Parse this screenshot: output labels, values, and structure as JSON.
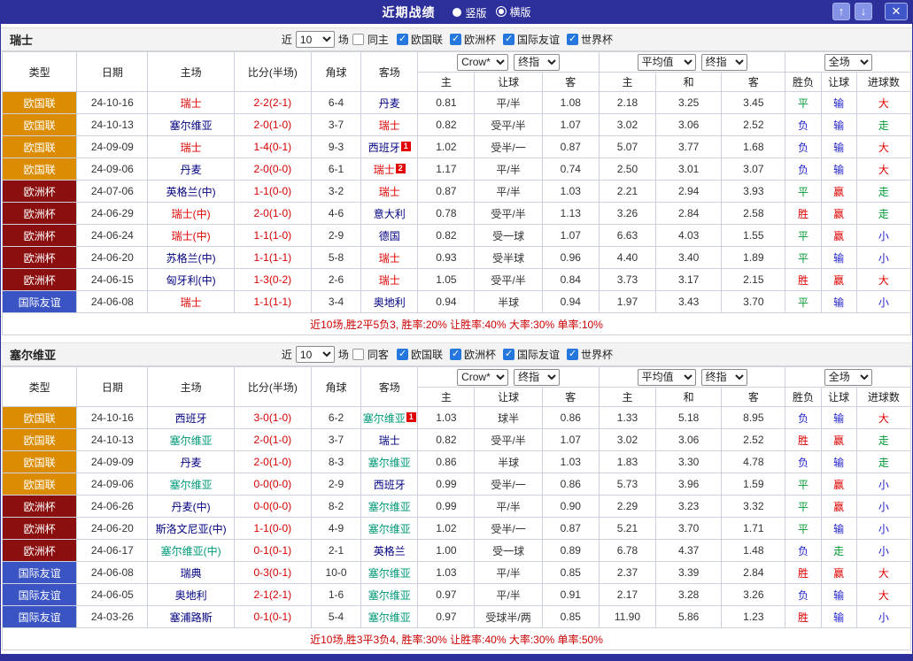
{
  "titlebar": {
    "title": "近期战绩",
    "layout_options": [
      {
        "label": "竖版",
        "selected": false
      },
      {
        "label": "横版",
        "selected": true
      }
    ],
    "icons": {
      "up": "↑",
      "down": "↓",
      "close": "✕"
    }
  },
  "colors": {
    "titlebar_bg": "#2d2f9b",
    "comp": {
      "欧国联": "#db8c00",
      "欧洲杯": "#8c0f0f",
      "国际友谊": "#3b54c4"
    },
    "result": {
      "red": "#e00000",
      "blue": "#2222cc",
      "green": "#009933"
    },
    "score": "#d60000",
    "team_default": "#000080",
    "summary": "#cc0000",
    "checkbox_checked": "#2577de"
  },
  "sections": [
    {
      "team": "瑞士",
      "focal_color": "#e00000",
      "filter": {
        "near_label": "近",
        "count": "10",
        "matches_label": "场",
        "same_label": "同主",
        "same_checked": false,
        "competitions": [
          {
            "label": "欧国联",
            "checked": true
          },
          {
            "label": "欧洲杯",
            "checked": true
          },
          {
            "label": "国际友谊",
            "checked": true
          },
          {
            "label": "世界杯",
            "checked": true
          }
        ]
      },
      "dropdowns": {
        "ah_book": "Crow*",
        "ah_time": "终指",
        "eu_avg": "平均值",
        "eu_time": "终指",
        "scope": "全场"
      },
      "columns": [
        "类型",
        "日期",
        "主场",
        "比分(半场)",
        "角球",
        "客场",
        "主",
        "让球",
        "客",
        "主",
        "和",
        "客",
        "胜负",
        "让球",
        "进球数"
      ],
      "rows": [
        {
          "comp": "欧国联",
          "date": "24-10-16",
          "home": {
            "name": "瑞士",
            "focal": true
          },
          "score": "2-2(2-1)",
          "corner": "6-4",
          "away": {
            "name": "丹麦"
          },
          "ah": [
            "0.81",
            "平/半",
            "1.08"
          ],
          "eu": [
            "2.18",
            "3.25",
            "3.45"
          ],
          "results": [
            [
              "平",
              "green"
            ],
            [
              "输",
              "blue"
            ],
            [
              "大",
              "red"
            ]
          ]
        },
        {
          "comp": "欧国联",
          "date": "24-10-13",
          "home": {
            "name": "塞尔维亚"
          },
          "score": "2-0(1-0)",
          "corner": "3-7",
          "away": {
            "name": "瑞士",
            "focal": true
          },
          "ah": [
            "0.82",
            "受平/半",
            "1.07"
          ],
          "eu": [
            "3.02",
            "3.06",
            "2.52"
          ],
          "results": [
            [
              "负",
              "blue"
            ],
            [
              "输",
              "blue"
            ],
            [
              "走",
              "green"
            ]
          ]
        },
        {
          "comp": "欧国联",
          "date": "24-09-09",
          "home": {
            "name": "瑞士",
            "focal": true
          },
          "score": "1-4(0-1)",
          "corner": "9-3",
          "away": {
            "name": "西班牙",
            "sup": "1"
          },
          "ah": [
            "1.02",
            "受半/一",
            "0.87"
          ],
          "eu": [
            "5.07",
            "3.77",
            "1.68"
          ],
          "results": [
            [
              "负",
              "blue"
            ],
            [
              "输",
              "blue"
            ],
            [
              "大",
              "red"
            ]
          ]
        },
        {
          "comp": "欧国联",
          "date": "24-09-06",
          "home": {
            "name": "丹麦"
          },
          "score": "2-0(0-0)",
          "corner": "6-1",
          "away": {
            "name": "瑞士",
            "focal": true,
            "sup": "2"
          },
          "ah": [
            "1.17",
            "平/半",
            "0.74"
          ],
          "eu": [
            "2.50",
            "3.01",
            "3.07"
          ],
          "results": [
            [
              "负",
              "blue"
            ],
            [
              "输",
              "blue"
            ],
            [
              "大",
              "red"
            ]
          ]
        },
        {
          "comp": "欧洲杯",
          "date": "24-07-06",
          "home": {
            "name": "英格兰(中)"
          },
          "score": "1-1(0-0)",
          "corner": "3-2",
          "away": {
            "name": "瑞士",
            "focal": true
          },
          "ah": [
            "0.87",
            "平/半",
            "1.03"
          ],
          "eu": [
            "2.21",
            "2.94",
            "3.93"
          ],
          "results": [
            [
              "平",
              "green"
            ],
            [
              "赢",
              "red"
            ],
            [
              "走",
              "green"
            ]
          ]
        },
        {
          "comp": "欧洲杯",
          "date": "24-06-29",
          "home": {
            "name": "瑞士(中)",
            "focal": true
          },
          "score": "2-0(1-0)",
          "corner": "4-6",
          "away": {
            "name": "意大利"
          },
          "ah": [
            "0.78",
            "受平/半",
            "1.13"
          ],
          "eu": [
            "3.26",
            "2.84",
            "2.58"
          ],
          "results": [
            [
              "胜",
              "red"
            ],
            [
              "赢",
              "red"
            ],
            [
              "走",
              "green"
            ]
          ]
        },
        {
          "comp": "欧洲杯",
          "date": "24-06-24",
          "home": {
            "name": "瑞士(中)",
            "focal": true
          },
          "score": "1-1(1-0)",
          "corner": "2-9",
          "away": {
            "name": "德国"
          },
          "ah": [
            "0.82",
            "受一球",
            "1.07"
          ],
          "eu": [
            "6.63",
            "4.03",
            "1.55"
          ],
          "results": [
            [
              "平",
              "green"
            ],
            [
              "赢",
              "red"
            ],
            [
              "小",
              "blue"
            ]
          ]
        },
        {
          "comp": "欧洲杯",
          "date": "24-06-20",
          "home": {
            "name": "苏格兰(中)"
          },
          "score": "1-1(1-1)",
          "corner": "5-8",
          "away": {
            "name": "瑞士",
            "focal": true
          },
          "ah": [
            "0.93",
            "受半球",
            "0.96"
          ],
          "eu": [
            "4.40",
            "3.40",
            "1.89"
          ],
          "results": [
            [
              "平",
              "green"
            ],
            [
              "输",
              "blue"
            ],
            [
              "小",
              "blue"
            ]
          ]
        },
        {
          "comp": "欧洲杯",
          "date": "24-06-15",
          "home": {
            "name": "匈牙利(中)"
          },
          "score": "1-3(0-2)",
          "corner": "2-6",
          "away": {
            "name": "瑞士",
            "focal": true
          },
          "ah": [
            "1.05",
            "受平/半",
            "0.84"
          ],
          "eu": [
            "3.73",
            "3.17",
            "2.15"
          ],
          "results": [
            [
              "胜",
              "red"
            ],
            [
              "赢",
              "red"
            ],
            [
              "大",
              "red"
            ]
          ]
        },
        {
          "comp": "国际友谊",
          "date": "24-06-08",
          "home": {
            "name": "瑞士",
            "focal": true
          },
          "score": "1-1(1-1)",
          "corner": "3-4",
          "away": {
            "name": "奥地利"
          },
          "ah": [
            "0.94",
            "半球",
            "0.94"
          ],
          "eu": [
            "1.97",
            "3.43",
            "3.70"
          ],
          "results": [
            [
              "平",
              "green"
            ],
            [
              "输",
              "blue"
            ],
            [
              "小",
              "blue"
            ]
          ]
        }
      ],
      "summary": "近10场,胜2平5负3, 胜率:20% 让胜率:40% 大率:30% 单率:10%"
    },
    {
      "team": "塞尔维亚",
      "focal_color": "#009977",
      "filter": {
        "near_label": "近",
        "count": "10",
        "matches_label": "场",
        "same_label": "同客",
        "same_checked": false,
        "competitions": [
          {
            "label": "欧国联",
            "checked": true
          },
          {
            "label": "欧洲杯",
            "checked": true
          },
          {
            "label": "国际友谊",
            "checked": true
          },
          {
            "label": "世界杯",
            "checked": true
          }
        ]
      },
      "dropdowns": {
        "ah_book": "Crow*",
        "ah_time": "终指",
        "eu_avg": "平均值",
        "eu_time": "终指",
        "scope": "全场"
      },
      "columns": [
        "类型",
        "日期",
        "主场",
        "比分(半场)",
        "角球",
        "客场",
        "主",
        "让球",
        "客",
        "主",
        "和",
        "客",
        "胜负",
        "让球",
        "进球数"
      ],
      "rows": [
        {
          "comp": "欧国联",
          "date": "24-10-16",
          "home": {
            "name": "西班牙"
          },
          "score": "3-0(1-0)",
          "corner": "6-2",
          "away": {
            "name": "塞尔维亚",
            "focal": true,
            "sup": "1"
          },
          "ah": [
            "1.03",
            "球半",
            "0.86"
          ],
          "eu": [
            "1.33",
            "5.18",
            "8.95"
          ],
          "results": [
            [
              "负",
              "blue"
            ],
            [
              "输",
              "blue"
            ],
            [
              "大",
              "red"
            ]
          ]
        },
        {
          "comp": "欧国联",
          "date": "24-10-13",
          "home": {
            "name": "塞尔维亚",
            "focal": true
          },
          "score": "2-0(1-0)",
          "corner": "3-7",
          "away": {
            "name": "瑞士"
          },
          "ah": [
            "0.82",
            "受平/半",
            "1.07"
          ],
          "eu": [
            "3.02",
            "3.06",
            "2.52"
          ],
          "results": [
            [
              "胜",
              "red"
            ],
            [
              "赢",
              "red"
            ],
            [
              "走",
              "green"
            ]
          ]
        },
        {
          "comp": "欧国联",
          "date": "24-09-09",
          "home": {
            "name": "丹麦"
          },
          "score": "2-0(1-0)",
          "corner": "8-3",
          "away": {
            "name": "塞尔维亚",
            "focal": true
          },
          "ah": [
            "0.86",
            "半球",
            "1.03"
          ],
          "eu": [
            "1.83",
            "3.30",
            "4.78"
          ],
          "results": [
            [
              "负",
              "blue"
            ],
            [
              "输",
              "blue"
            ],
            [
              "走",
              "green"
            ]
          ]
        },
        {
          "comp": "欧国联",
          "date": "24-09-06",
          "home": {
            "name": "塞尔维亚",
            "focal": true
          },
          "score": "0-0(0-0)",
          "corner": "2-9",
          "away": {
            "name": "西班牙"
          },
          "ah": [
            "0.99",
            "受半/一",
            "0.86"
          ],
          "eu": [
            "5.73",
            "3.96",
            "1.59"
          ],
          "results": [
            [
              "平",
              "green"
            ],
            [
              "赢",
              "red"
            ],
            [
              "小",
              "blue"
            ]
          ]
        },
        {
          "comp": "欧洲杯",
          "date": "24-06-26",
          "home": {
            "name": "丹麦(中)"
          },
          "score": "0-0(0-0)",
          "corner": "8-2",
          "away": {
            "name": "塞尔维亚",
            "focal": true
          },
          "ah": [
            "0.99",
            "平/半",
            "0.90"
          ],
          "eu": [
            "2.29",
            "3.23",
            "3.32"
          ],
          "results": [
            [
              "平",
              "green"
            ],
            [
              "赢",
              "red"
            ],
            [
              "小",
              "blue"
            ]
          ]
        },
        {
          "comp": "欧洲杯",
          "date": "24-06-20",
          "home": {
            "name": "斯洛文尼亚(中)"
          },
          "score": "1-1(0-0)",
          "corner": "4-9",
          "away": {
            "name": "塞尔维亚",
            "focal": true
          },
          "ah": [
            "1.02",
            "受半/一",
            "0.87"
          ],
          "eu": [
            "5.21",
            "3.70",
            "1.71"
          ],
          "results": [
            [
              "平",
              "green"
            ],
            [
              "输",
              "blue"
            ],
            [
              "小",
              "blue"
            ]
          ]
        },
        {
          "comp": "欧洲杯",
          "date": "24-06-17",
          "home": {
            "name": "塞尔维亚(中)",
            "focal": true
          },
          "score": "0-1(0-1)",
          "corner": "2-1",
          "away": {
            "name": "英格兰"
          },
          "ah": [
            "1.00",
            "受一球",
            "0.89"
          ],
          "eu": [
            "6.78",
            "4.37",
            "1.48"
          ],
          "results": [
            [
              "负",
              "blue"
            ],
            [
              "走",
              "green"
            ],
            [
              "小",
              "blue"
            ]
          ]
        },
        {
          "comp": "国际友谊",
          "date": "24-06-08",
          "home": {
            "name": "瑞典"
          },
          "score": "0-3(0-1)",
          "corner": "10-0",
          "away": {
            "name": "塞尔维亚",
            "focal": true
          },
          "ah": [
            "1.03",
            "平/半",
            "0.85"
          ],
          "eu": [
            "2.37",
            "3.39",
            "2.84"
          ],
          "results": [
            [
              "胜",
              "red"
            ],
            [
              "赢",
              "red"
            ],
            [
              "大",
              "red"
            ]
          ]
        },
        {
          "comp": "国际友谊",
          "date": "24-06-05",
          "home": {
            "name": "奥地利"
          },
          "score": "2-1(2-1)",
          "corner": "1-6",
          "away": {
            "name": "塞尔维亚",
            "focal": true
          },
          "ah": [
            "0.97",
            "平/半",
            "0.91"
          ],
          "eu": [
            "2.17",
            "3.28",
            "3.26"
          ],
          "results": [
            [
              "负",
              "blue"
            ],
            [
              "输",
              "blue"
            ],
            [
              "大",
              "red"
            ]
          ]
        },
        {
          "comp": "国际友谊",
          "date": "24-03-26",
          "home": {
            "name": "塞浦路斯"
          },
          "score": "0-1(0-1)",
          "corner": "5-4",
          "away": {
            "name": "塞尔维亚",
            "focal": true
          },
          "ah": [
            "0.97",
            "受球半/两",
            "0.85"
          ],
          "eu": [
            "11.90",
            "5.86",
            "1.23"
          ],
          "results": [
            [
              "胜",
              "red"
            ],
            [
              "输",
              "blue"
            ],
            [
              "小",
              "blue"
            ]
          ]
        }
      ],
      "summary": "近10场,胜3平3负4, 胜率:30% 让胜率:40% 大率:30% 单率:50%"
    }
  ]
}
